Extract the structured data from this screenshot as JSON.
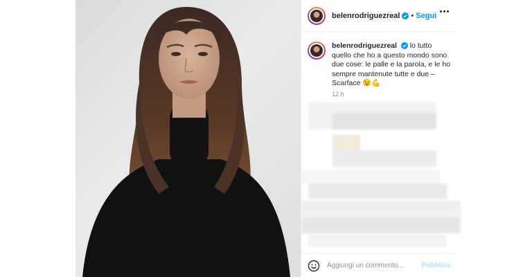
{
  "post": {
    "username": "belenrodriguezreal",
    "follow_label": "Segui",
    "caption_username": "belenrodriguezreal",
    "caption_text": "lo tutto quello che ho a questo mondo sono due cose: le palle e la parola, e le ho sempre mantenute tutte e due – Scarface 😉💪",
    "time": "12 h",
    "comment_placeholder": "Aggiungi un commento...",
    "publish_label": "Pubblica"
  },
  "icons": {
    "verified": "verified-badge-icon",
    "more": "more-options-icon",
    "emoji": "emoji-icon"
  },
  "colors": {
    "accent": "#0095f6",
    "publish_disabled": "#b2dffc",
    "muted": "#8e8e8e"
  }
}
